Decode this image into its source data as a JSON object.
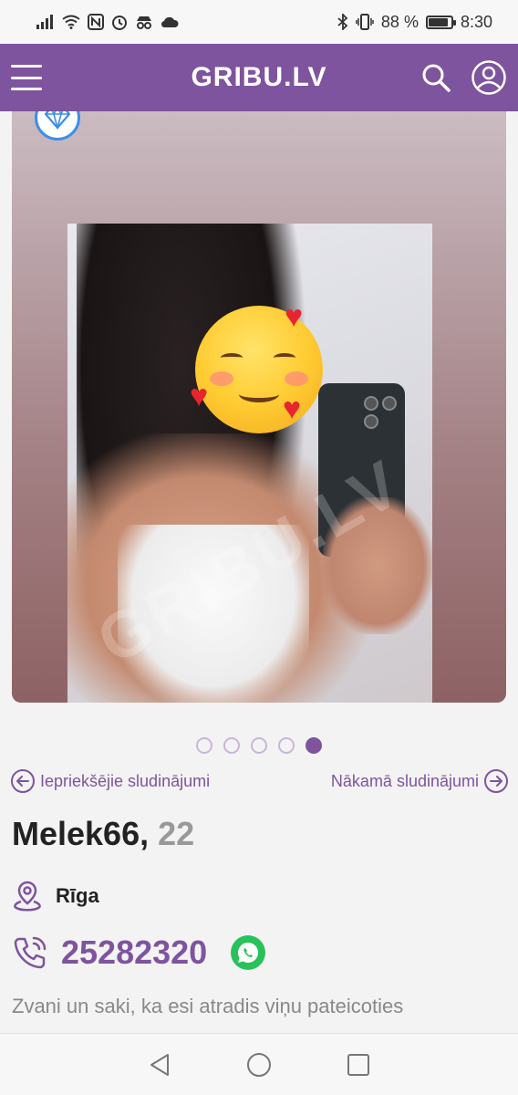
{
  "status_bar": {
    "battery_percent": "88 %",
    "time": "8:30",
    "battery_level": 0.88,
    "left_icons": [
      "signal-icon",
      "wifi-icon",
      "nfc-icon",
      "alarm-icon",
      "incognito-icon",
      "cloud-icon"
    ],
    "right_icons": [
      "bluetooth-icon",
      "vibrate-icon"
    ]
  },
  "header": {
    "logo": "GRIBU.LV",
    "background": "#7e549e"
  },
  "gallery": {
    "watermark": "GRIBU.LV",
    "total_photos": 5,
    "active_index": 4,
    "badge_icon": "diamond-icon"
  },
  "navigation": {
    "prev_label": "Iepriekšējie sludinājumi",
    "next_label": "Nākamā sludinājumi"
  },
  "profile": {
    "name": "Melek66,",
    "age": "22",
    "location": "Rīga",
    "phone": "25282320"
  },
  "note": "Zvani un saki, ka esi atradis viņu pateicoties",
  "colors": {
    "accent": "#7e549e",
    "whatsapp": "#29c25a",
    "badge_blue": "#3d8ee8"
  }
}
